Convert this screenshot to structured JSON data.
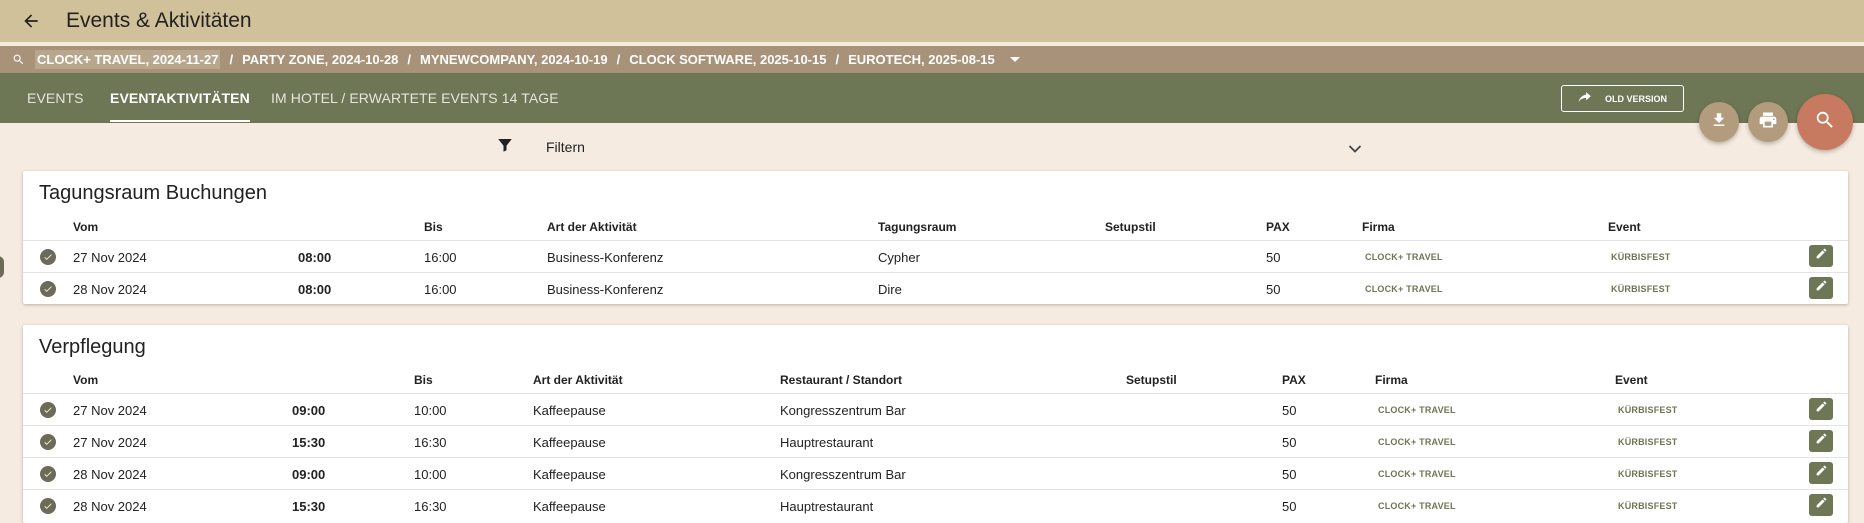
{
  "header": {
    "title": "Events & Aktivitäten"
  },
  "breadcrumbs": [
    "CLOCK+ TRAVEL, 2024-11-27",
    "PARTY ZONE, 2024-10-28",
    "MYNEWCOMPANY, 2024-10-19",
    "CLOCK SOFTWARE, 2025-10-15",
    "EUROTECH, 2025-08-15"
  ],
  "tabs": [
    {
      "label": "EVENTS"
    },
    {
      "label": "EVENTAKTIVITÄTEN"
    },
    {
      "label": "IM HOTEL / ERWARTETE EVENTS 14 TAGE"
    }
  ],
  "old_version_label": "OLD VERSION",
  "filter": {
    "label": "Filtern"
  },
  "meeting_rooms": {
    "title": "Tagungsraum Buchungen",
    "columns": [
      "Vom",
      "Bis",
      "Art der Aktivität",
      "Tagungsraum",
      "Setupstil",
      "PAX",
      "Firma",
      "Event"
    ],
    "rows": [
      {
        "date": "27 Nov 2024",
        "from": "08:00",
        "to": "16:00",
        "activity": "Business-Konferenz",
        "room": "Cypher",
        "setup": "",
        "pax": "50",
        "company": "CLOCK+ TRAVEL",
        "event": "KÜRBISFEST"
      },
      {
        "date": "28 Nov 2024",
        "from": "08:00",
        "to": "16:00",
        "activity": "Business-Konferenz",
        "room": "Dire",
        "setup": "",
        "pax": "50",
        "company": "CLOCK+ TRAVEL",
        "event": "KÜRBISFEST"
      }
    ]
  },
  "catering": {
    "title": "Verpflegung",
    "columns": [
      "Vom",
      "Bis",
      "Art der Aktivität",
      "Restaurant / Standort",
      "Setupstil",
      "PAX",
      "Firma",
      "Event"
    ],
    "rows": [
      {
        "date": "27 Nov 2024",
        "from": "09:00",
        "to": "10:00",
        "activity": "Kaffeepause",
        "location": "Kongresszentrum Bar",
        "setup": "",
        "pax": "50",
        "company": "CLOCK+ TRAVEL",
        "event": "KÜRBISFEST"
      },
      {
        "date": "27 Nov 2024",
        "from": "15:30",
        "to": "16:30",
        "activity": "Kaffeepause",
        "location": "Hauptrestaurant",
        "setup": "",
        "pax": "50",
        "company": "CLOCK+ TRAVEL",
        "event": "KÜRBISFEST"
      },
      {
        "date": "28 Nov 2024",
        "from": "09:00",
        "to": "10:00",
        "activity": "Kaffeepause",
        "location": "Kongresszentrum Bar",
        "setup": "",
        "pax": "50",
        "company": "CLOCK+ TRAVEL",
        "event": "KÜRBISFEST"
      },
      {
        "date": "28 Nov 2024",
        "from": "15:30",
        "to": "16:30",
        "activity": "Kaffeepause",
        "location": "Hauptrestaurant",
        "setup": "",
        "pax": "50",
        "company": "CLOCK+ TRAVEL",
        "event": "KÜRBISFEST"
      }
    ]
  },
  "icons": {
    "back": "arrow-left-icon",
    "search": "search-icon",
    "dropdown": "caret-down-icon",
    "redo": "redo-arrow-icon",
    "download": "download-icon",
    "print": "print-icon",
    "filter": "filter-funnel-icon",
    "chevron": "chevron-down-icon",
    "check": "check-circle-icon",
    "edit": "pencil-icon"
  },
  "colors": {
    "topbar": "#d1c19b",
    "breadcrumb_bar": "#a8937a",
    "tab_bar": "#6d7655",
    "background": "#f5ebe0",
    "accent_fab": "#c77a5f",
    "secondary_fab": "#b29c7d",
    "chip_text": "#6d7655"
  }
}
